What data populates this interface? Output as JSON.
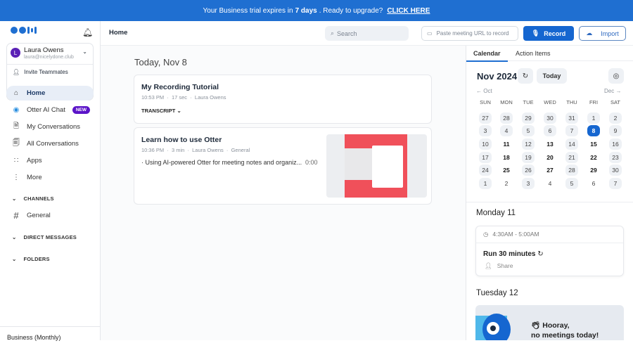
{
  "banner": {
    "pre": "Your Business trial expires in",
    "days": "7 days",
    "post": ". Ready to upgrade?",
    "link": "CLICK HERE"
  },
  "sidebar": {
    "user": {
      "initial": "L",
      "name": "Laura Owens",
      "email": "laura@nicelydone.club"
    },
    "invite": "Invite Teammates",
    "nav": [
      {
        "label": "Home",
        "icon": "home-icon"
      },
      {
        "label": "Otter AI Chat",
        "icon": "otter-chat-icon",
        "badge": "NEW"
      },
      {
        "label": "My Conversations",
        "icon": "document-icon"
      },
      {
        "label": "All Conversations",
        "icon": "documents-icon"
      },
      {
        "label": "Apps",
        "icon": "apps-icon"
      },
      {
        "label": "More",
        "icon": "more-icon"
      }
    ],
    "sections": {
      "channels": "CHANNELS",
      "general": "General",
      "dms": "DIRECT MESSAGES",
      "folders": "FOLDERS"
    },
    "plan": "Business (Monthly)"
  },
  "topbar": {
    "title": "Home",
    "search_placeholder": "Search",
    "url_placeholder": "Paste meeting URL to record",
    "record": "Record",
    "import": "Import"
  },
  "main": {
    "date": "Today, Nov 8",
    "cards": [
      {
        "title": "My Recording Tutorial",
        "time": "10:53 PM",
        "duration": "17 sec",
        "owner": "Laura Owens",
        "transcript": "TRANSCRIPT"
      },
      {
        "title": "Learn how to use Otter",
        "time": "10:36 PM",
        "duration": "3 min",
        "owner": "Laura Owens",
        "channel": "General",
        "snippet": "Using AI-powered Otter for meeting notes and organiz...",
        "snippet_time": "0:00"
      }
    ]
  },
  "right": {
    "tabs": [
      "Calendar",
      "Action Items"
    ],
    "month": "Nov 2024",
    "today": "Today",
    "prev": "Oct",
    "next": "Dec",
    "dow": [
      "SUN",
      "MON",
      "TUE",
      "WED",
      "THU",
      "FRI",
      "SAT"
    ],
    "days": [
      [
        [
          "27",
          "bg"
        ],
        [
          "28",
          "bg"
        ],
        [
          "29",
          "bg"
        ],
        [
          "30",
          "bg"
        ],
        [
          "31",
          "bg"
        ],
        [
          "1",
          "bg"
        ],
        [
          "2",
          "bg"
        ]
      ],
      [
        [
          "3",
          "bg"
        ],
        [
          "4",
          "bg"
        ],
        [
          "5",
          "bg"
        ],
        [
          "6",
          "bg"
        ],
        [
          "7",
          "bg"
        ],
        [
          "8",
          "sel"
        ],
        [
          "9",
          "bg"
        ]
      ],
      [
        [
          "10",
          "bg"
        ],
        [
          "11",
          "bold"
        ],
        [
          "12",
          "bg"
        ],
        [
          "13",
          "bold"
        ],
        [
          "14",
          "bg"
        ],
        [
          "15",
          "bold"
        ],
        [
          "16",
          "bg"
        ]
      ],
      [
        [
          "17",
          "bg"
        ],
        [
          "18",
          "bold"
        ],
        [
          "19",
          "bg"
        ],
        [
          "20",
          "bold"
        ],
        [
          "21",
          "bg"
        ],
        [
          "22",
          "bold"
        ],
        [
          "23",
          "bg"
        ]
      ],
      [
        [
          "24",
          "bg"
        ],
        [
          "25",
          "bold"
        ],
        [
          "26",
          "bg"
        ],
        [
          "27",
          "bold"
        ],
        [
          "28",
          "bg"
        ],
        [
          "29",
          "bold"
        ],
        [
          "30",
          "bg"
        ]
      ],
      [
        [
          "1",
          "bg"
        ],
        [
          "2",
          ""
        ],
        [
          "3",
          "bg"
        ],
        [
          "4",
          ""
        ],
        [
          "5",
          "bg"
        ],
        [
          "6",
          ""
        ],
        [
          "7",
          "bg"
        ]
      ]
    ],
    "day1": "Monday 11",
    "event": {
      "time": "4:30AM - 5:00AM",
      "title": "Run 30 minutes",
      "share": "Share"
    },
    "day2": "Tuesday 12",
    "hooray1": "Hooray,",
    "hooray2": "no meetings today!"
  }
}
